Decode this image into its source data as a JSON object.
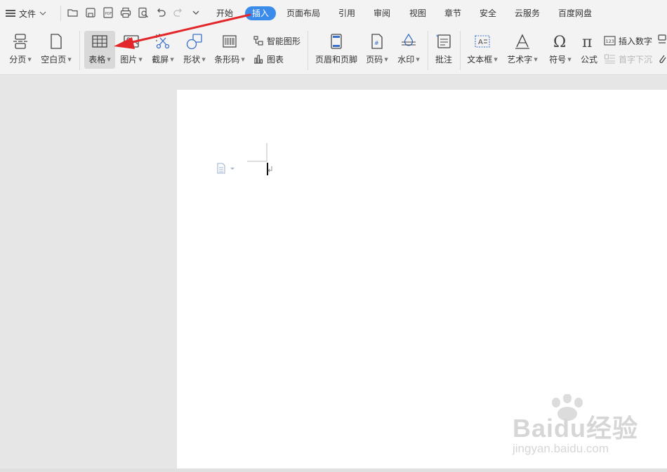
{
  "menu": {
    "file_label": "文件"
  },
  "tabs": [
    "开始",
    "插入",
    "页面布局",
    "引用",
    "审阅",
    "视图",
    "章节",
    "安全",
    "云服务",
    "百度网盘"
  ],
  "active_tab": "插入",
  "ribbon": {
    "page_break": "分页",
    "blank_page": "空白页",
    "table": "表格",
    "picture": "图片",
    "screenshot": "截屏",
    "shape": "形状",
    "barcode": "条形码",
    "smart_graphic": "智能图形",
    "chart": "图表",
    "header_footer": "页眉和页脚",
    "page_number": "页码",
    "watermark": "水印",
    "comment": "批注",
    "textbox": "文本框",
    "wordart": "艺术字",
    "symbol": "符号",
    "formula": "公式",
    "insert_number": "插入数字",
    "drop_cap": "首字下沉"
  },
  "watermark": {
    "main": "Baidu经验",
    "sub": "jingyan.baidu.com"
  },
  "colors": {
    "accent": "#3b8bea",
    "arrow": "#e3262a"
  }
}
